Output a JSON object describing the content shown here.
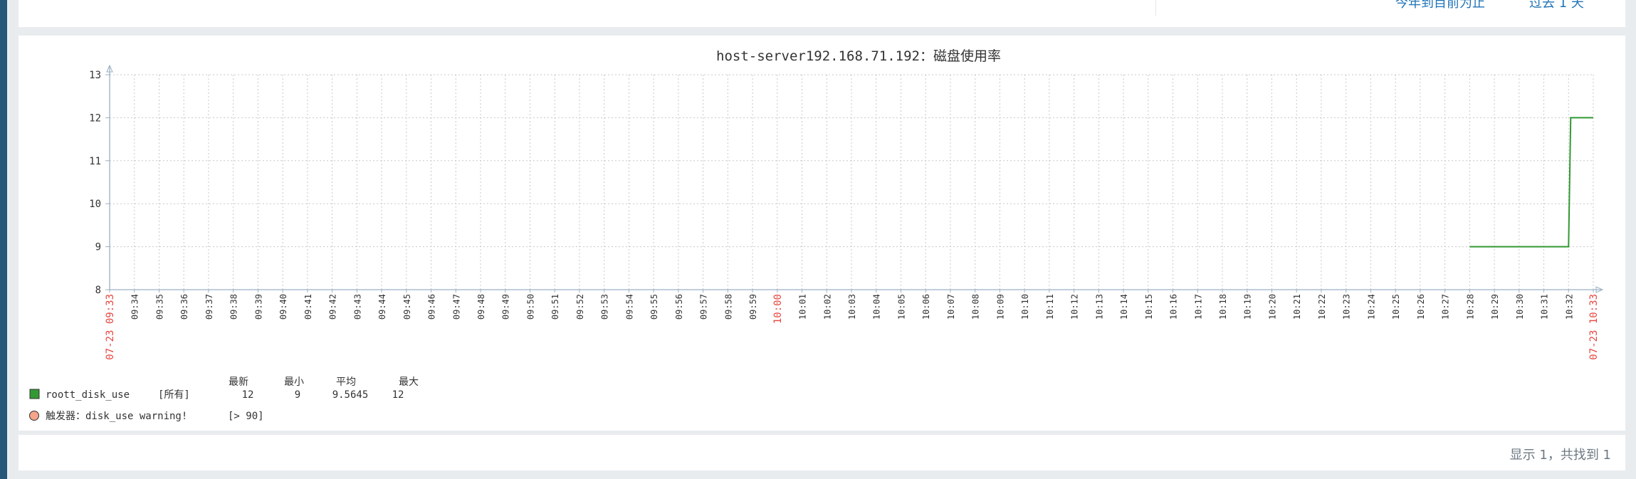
{
  "top_links": [
    "今年到目前为止",
    "过去 1 天"
  ],
  "paging_text": "显示 1，共找到 1",
  "chart_data": {
    "type": "line",
    "title": "host-server192.168.71.192：磁盘使用率",
    "ylim": [
      8,
      13
    ],
    "y_ticks": [
      "13",
      "12",
      "11",
      "10",
      "9",
      "8"
    ],
    "x_labels": [
      "07-23 09:33",
      "09:34",
      "09:35",
      "09:36",
      "09:37",
      "09:38",
      "09:39",
      "09:40",
      "09:41",
      "09:42",
      "09:43",
      "09:44",
      "09:45",
      "09:46",
      "09:47",
      "09:48",
      "09:49",
      "09:50",
      "09:51",
      "09:52",
      "09:53",
      "09:54",
      "09:55",
      "09:56",
      "09:57",
      "09:58",
      "09:59",
      "10:00",
      "10:01",
      "10:02",
      "10:03",
      "10:04",
      "10:05",
      "10:06",
      "10:07",
      "10:08",
      "10:09",
      "10:10",
      "10:11",
      "10:12",
      "10:13",
      "10:14",
      "10:15",
      "10:16",
      "10:17",
      "10:18",
      "10:19",
      "10:20",
      "10:21",
      "10:22",
      "10:23",
      "10:24",
      "10:25",
      "10:26",
      "10:27",
      "10:28",
      "10:29",
      "10:30",
      "10:31",
      "10:32",
      "07-23 10:33"
    ],
    "highlight_labels": [
      "07-23 09:33",
      "10:00",
      "07-23 10:33"
    ],
    "grid": true,
    "series": [
      {
        "name": "roott_disk_use",
        "color": "#339933",
        "x": [
          "10:28",
          "10:32",
          "10:32",
          "10:33"
        ],
        "y": [
          9,
          9,
          12,
          12
        ]
      }
    ],
    "legend": {
      "headers": [
        "最新",
        "最小",
        "平均",
        "最大"
      ],
      "row": {
        "name": "roott_disk_use",
        "scope": "[所有]",
        "values": [
          "12",
          "9",
          "9.5645",
          "12"
        ],
        "color": "#339933"
      },
      "trigger": {
        "label": "触发器：disk_use warning!",
        "condition": "[> 90]",
        "color": "#f4a58a"
      }
    }
  }
}
